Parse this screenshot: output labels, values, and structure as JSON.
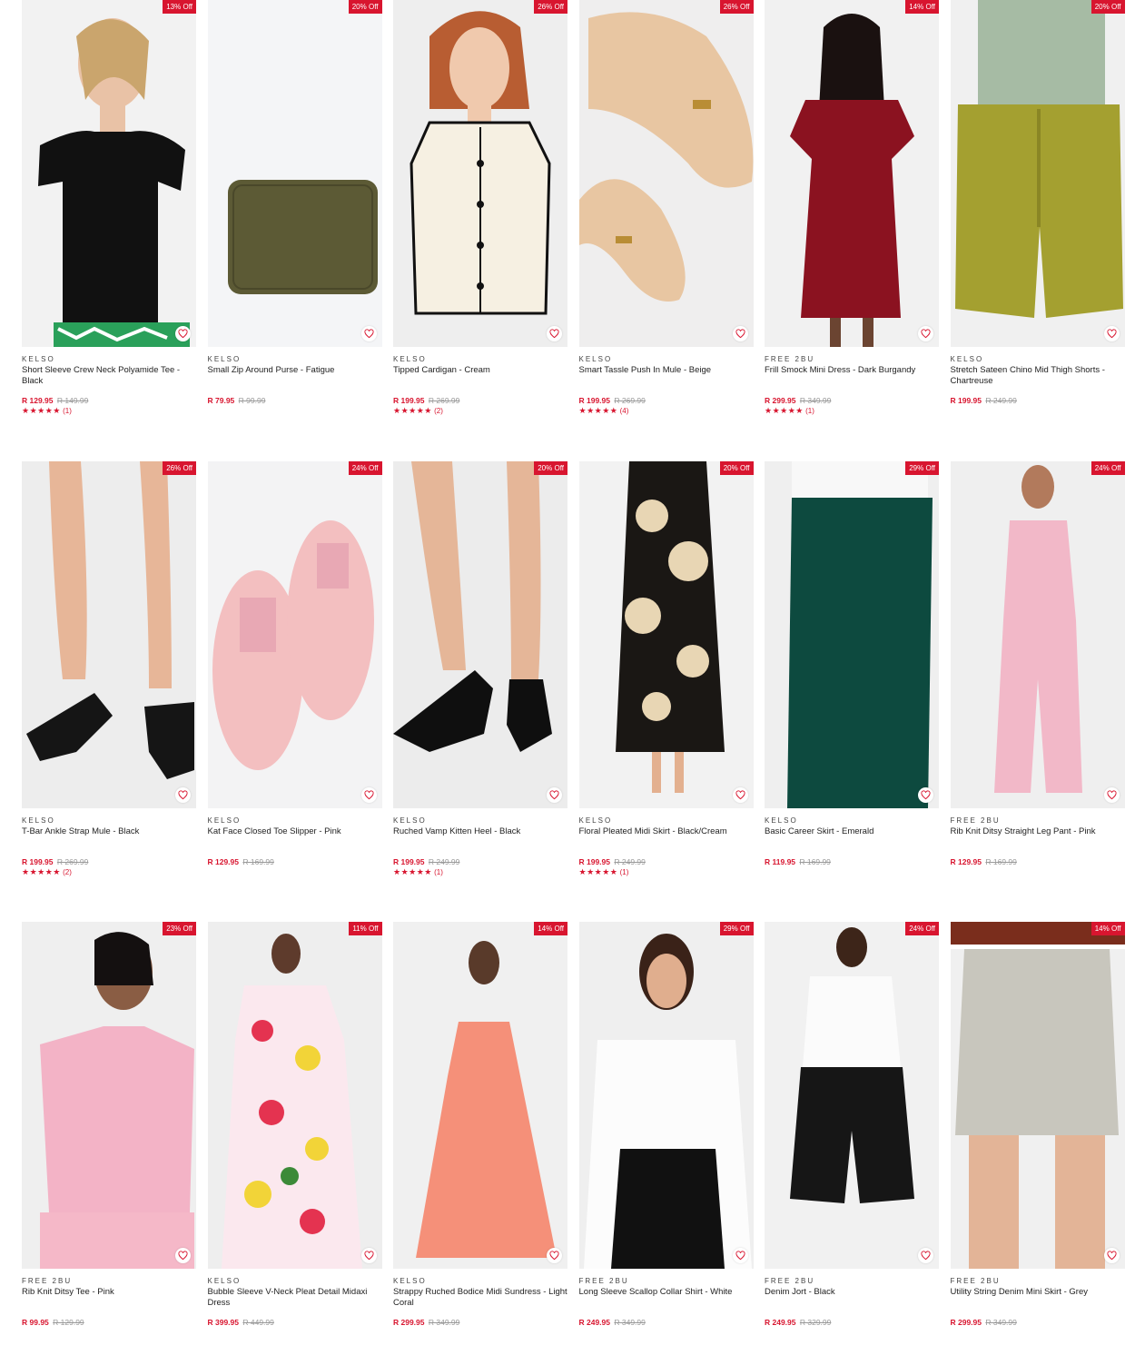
{
  "colors": {
    "accent": "#d8152f",
    "image_bg": "#eeeff1"
  },
  "rows": [
    [
      {
        "brand": "KELSO",
        "name": "Short Sleeve Crew Neck Polyamide Tee - Black",
        "price": "R 129.95",
        "was": "R 149.99",
        "badge": "13% Off",
        "stars": "★★★★★",
        "reviews": "(1)",
        "art": "tee-black"
      },
      {
        "brand": "KELSO",
        "name": "Small Zip Around Purse - Fatigue",
        "price": "R 79.95",
        "was": "R 99.99",
        "badge": "20% Off",
        "stars": "",
        "reviews": "",
        "art": "purse"
      },
      {
        "brand": "KELSO",
        "name": "Tipped Cardigan - Cream",
        "price": "R 199.95",
        "was": "R 269.99",
        "badge": "26% Off",
        "stars": "★★★★★",
        "reviews": "(2)",
        "art": "cardigan"
      },
      {
        "brand": "KELSO",
        "name": "Smart Tassle Push In Mule - Beige",
        "price": "R 199.95",
        "was": "R 269.99",
        "badge": "26% Off",
        "stars": "★★★★★",
        "reviews": "(4)",
        "art": "mule"
      },
      {
        "brand": "FREE 2BU",
        "name": "Frill Smock Mini Dress - Dark Burgandy",
        "price": "R 299.95",
        "was": "R 349.99",
        "badge": "14% Off",
        "stars": "★★★★★",
        "reviews": "(1)",
        "art": "dress-red"
      },
      {
        "brand": "KELSO",
        "name": "Stretch Sateen Chino Mid Thigh Shorts - Chartreuse",
        "price": "R 199.95",
        "was": "R 249.99",
        "badge": "20% Off",
        "stars": "",
        "reviews": "",
        "art": "shorts"
      }
    ],
    [
      {
        "brand": "KELSO",
        "name": "T-Bar Ankle Strap Mule - Black",
        "price": "R 199.95",
        "was": "R 269.99",
        "badge": "26% Off",
        "stars": "★★★★★",
        "reviews": "(2)",
        "art": "flats"
      },
      {
        "brand": "KELSO",
        "name": "Kat Face Closed Toe Slipper - Pink",
        "price": "R 129.95",
        "was": "R 169.99",
        "badge": "24% Off",
        "stars": "",
        "reviews": "",
        "art": "slipper"
      },
      {
        "brand": "KELSO",
        "name": "Ruched Vamp Kitten Heel - Black",
        "price": "R 199.95",
        "was": "R 249.99",
        "badge": "20% Off",
        "stars": "★★★★★",
        "reviews": "(1)",
        "art": "heels"
      },
      {
        "brand": "KELSO",
        "name": "Floral Pleated Midi Skirt - Black/Cream",
        "price": "R 199.95",
        "was": "R 249.99",
        "badge": "20% Off",
        "stars": "★★★★★",
        "reviews": "(1)",
        "art": "floral-skirt"
      },
      {
        "brand": "KELSO",
        "name": "Basic Career Skirt - Emerald",
        "price": "R 119.95",
        "was": "R 169.99",
        "badge": "29% Off",
        "stars": "",
        "reviews": "",
        "art": "green-skirt"
      },
      {
        "brand": "FREE 2BU",
        "name": "Rib Knit Ditsy Straight Leg Pant - Pink",
        "price": "R 129.95",
        "was": "R 169.99",
        "badge": "24% Off",
        "stars": "",
        "reviews": "",
        "art": "pink-set"
      }
    ],
    [
      {
        "brand": "FREE 2BU",
        "name": "Rib Knit Ditsy Tee - Pink",
        "price": "R 99.95",
        "was": "R 129.99",
        "badge": "23% Off",
        "stars": "",
        "reviews": "",
        "art": "pink-tee"
      },
      {
        "brand": "KELSO",
        "name": "Bubble Sleeve V-Neck Pleat Detail Midaxi Dress",
        "price": "R 399.95",
        "was": "R 449.99",
        "badge": "11% Off",
        "stars": "",
        "reviews": "",
        "art": "floral-dress"
      },
      {
        "brand": "KELSO",
        "name": "Strappy Ruched Bodice Midi Sundress - Light Coral",
        "price": "R 299.95",
        "was": "R 349.99",
        "badge": "14% Off",
        "stars": "",
        "reviews": "",
        "art": "coral-dress"
      },
      {
        "brand": "FREE 2BU",
        "name": "Long Sleeve Scallop Collar Shirt - White",
        "price": "R 249.95",
        "was": "R 349.99",
        "badge": "29% Off",
        "stars": "",
        "reviews": "",
        "art": "white-shirt"
      },
      {
        "brand": "FREE 2BU",
        "name": "Denim Jort - Black",
        "price": "R 249.95",
        "was": "R 329.99",
        "badge": "24% Off",
        "stars": "",
        "reviews": "",
        "art": "jort"
      },
      {
        "brand": "FREE 2BU",
        "name": "Utility String Denim Mini Skirt - Grey",
        "price": "R 299.95",
        "was": "R 349.99",
        "badge": "14% Off",
        "stars": "",
        "reviews": "",
        "art": "denim-skirt"
      }
    ]
  ]
}
